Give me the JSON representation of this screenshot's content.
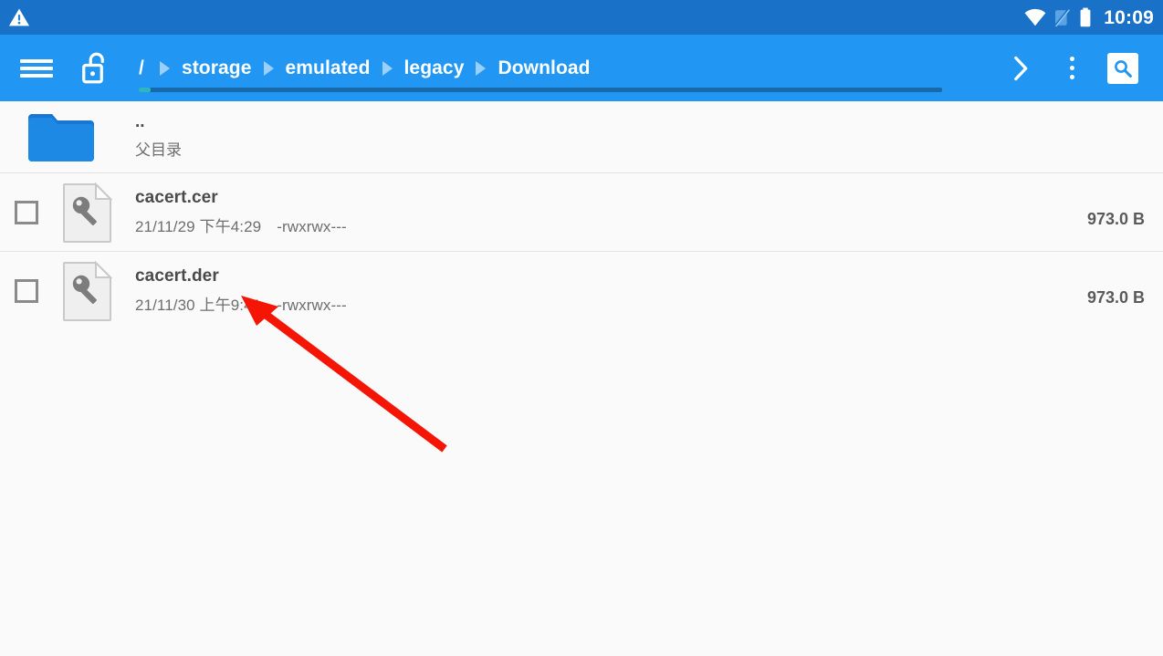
{
  "status_bar": {
    "warning_icon": "warning-triangle-icon",
    "wifi_icon": "wifi-icon",
    "signal_icon": "signal-off-icon",
    "battery_icon": "battery-full-icon",
    "time": "10:09",
    "background_color": "#1A72C8"
  },
  "app_bar": {
    "background_color": "#2196F3",
    "menu_icon": "hamburger-menu-icon",
    "lock_icon": "unlocked-padlock-icon",
    "forward_icon": "chevron-right-icon",
    "overflow_icon": "three-dots-vertical-icon",
    "search_icon": "search-icon",
    "breadcrumb": {
      "root": "/",
      "items": [
        "storage",
        "emulated",
        "legacy",
        "Download"
      ],
      "separator_icon": "triangle-right-icon",
      "scrollbar_color": "#2EB6BE"
    }
  },
  "file_list": {
    "parent_entry": {
      "icon": "folder-icon",
      "name": "..",
      "subtitle": "父目录"
    },
    "columns": [
      "selected",
      "icon",
      "name",
      "modified",
      "permissions",
      "size"
    ],
    "items": [
      {
        "icon": "certificate-key-file-icon",
        "name": "cacert.cer",
        "modified": "21/11/29 下午4:29",
        "permissions": "-rwxrwx---",
        "size": "973.0 B",
        "selected": false
      },
      {
        "icon": "certificate-key-file-icon",
        "name": "cacert.der",
        "modified": "21/11/30 上午9:41",
        "permissions": "-rwxrwx---",
        "size": "973.0 B",
        "selected": false
      }
    ]
  },
  "annotation": {
    "arrow_color": "#F41505",
    "arrow_tip": "265,324",
    "arrow_tail": "487,492"
  }
}
